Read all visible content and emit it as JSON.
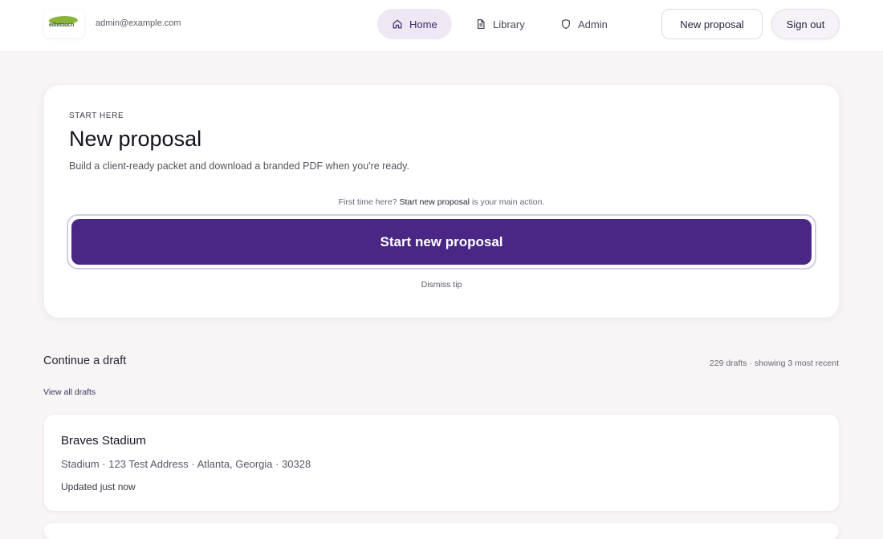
{
  "header": {
    "logo_text": "elitetouch",
    "email": "admin@example.com",
    "nav": [
      {
        "label": "Home",
        "icon": "home-icon",
        "active": true
      },
      {
        "label": "Library",
        "icon": "document-icon",
        "active": false
      },
      {
        "label": "Admin",
        "icon": "shield-icon",
        "active": false
      }
    ],
    "new_proposal_label": "New proposal",
    "sign_out_label": "Sign out"
  },
  "hero": {
    "eyebrow": "START HERE",
    "title": "New proposal",
    "subtitle": "Build a client-ready packet and download a branded PDF when you're ready.",
    "hint_prefix": "First time here?",
    "hint_action": "Start new proposal",
    "hint_suffix": "is your main action.",
    "primary_label": "Start new proposal",
    "dismiss_label": "Dismiss tip"
  },
  "drafts": {
    "title": "Continue a draft",
    "count_text": "229 drafts · showing 3 most recent",
    "view_all_label": "View all drafts",
    "items": [
      {
        "name": "Braves Stadium",
        "meta": "Stadium · 123 Test Address · Atlanta, Georgia · 30328",
        "updated": "Updated just now"
      }
    ]
  },
  "colors": {
    "primary": "#4a2785",
    "active_nav_bg": "#ede8f3",
    "page_bg": "#f8f5f6"
  }
}
